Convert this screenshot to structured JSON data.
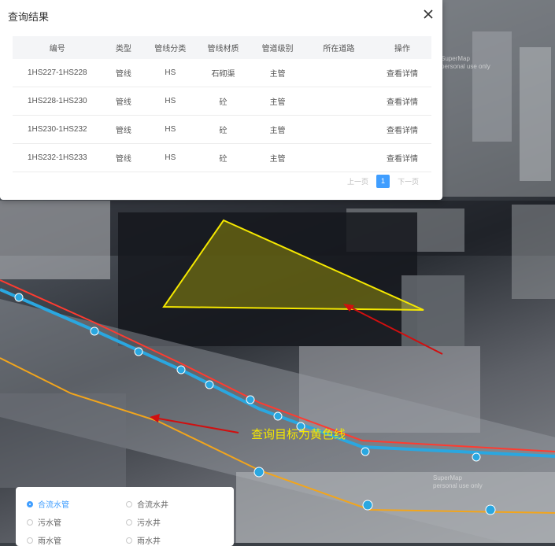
{
  "dialog": {
    "title": "查询结果",
    "columns": [
      "编号",
      "类型",
      "管线分类",
      "管线材质",
      "管道级别",
      "所在道路",
      "操作"
    ],
    "rows": [
      {
        "id": "1HS227-1HS228",
        "type": "管线",
        "category": "HS",
        "material": "石砌渠",
        "level": "主管",
        "road": "",
        "action": "查看详情"
      },
      {
        "id": "1HS228-1HS230",
        "type": "管线",
        "category": "HS",
        "material": "砼",
        "level": "主管",
        "road": "",
        "action": "查看详情"
      },
      {
        "id": "1HS230-1HS232",
        "type": "管线",
        "category": "HS",
        "material": "砼",
        "level": "主管",
        "road": "",
        "action": "查看详情"
      },
      {
        "id": "1HS232-1HS233",
        "type": "管线",
        "category": "HS",
        "material": "砼",
        "level": "主管",
        "road": "",
        "action": "查看详情"
      }
    ],
    "pager": {
      "prev": "上一页",
      "page": "1",
      "next": "下一页"
    }
  },
  "map": {
    "annotation": "查询目标为黄色线",
    "watermark_1": "SuperMap\npersonal use only",
    "watermark_2": "SuperMap\npersonal use only",
    "colors": {
      "highlight": "#f5e800",
      "rain_pipe": "#ff3b30",
      "sewer_pipe": "#2aa7e0",
      "combined_pipe": "#f2a51c",
      "arrow": "#d10f0f"
    }
  },
  "legend": {
    "items": [
      {
        "label": "合流水管",
        "selected": true
      },
      {
        "label": "合流水井",
        "selected": false
      },
      {
        "label": "污水管",
        "selected": false
      },
      {
        "label": "污水井",
        "selected": false
      },
      {
        "label": "雨水管",
        "selected": false
      },
      {
        "label": "雨水井",
        "selected": false
      }
    ],
    "accent": "#409eff"
  }
}
